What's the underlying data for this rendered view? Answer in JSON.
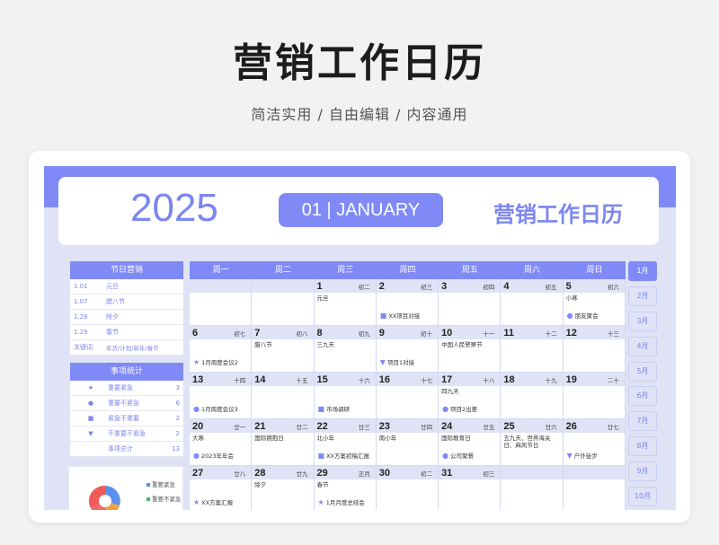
{
  "title": "营销工作日历",
  "subtitle": "简洁实用 / 自由编辑 / 内容通用",
  "header": {
    "year": "2025",
    "month": "01 | JANUARY",
    "brand": "营销工作日历"
  },
  "holidays": {
    "head": "节日营销",
    "rows": [
      {
        "date": "1.01",
        "name": "元旦"
      },
      {
        "date": "1.07",
        "name": "腊八节"
      },
      {
        "date": "1.28",
        "name": "除夕"
      },
      {
        "date": "1.29",
        "name": "春节"
      },
      {
        "date": "关键词",
        "name": "年货/计划/新年/春节"
      }
    ]
  },
  "stats": {
    "head": "事项统计",
    "rows": [
      {
        "icon": "★",
        "label": "重要紧急",
        "count": "3"
      },
      {
        "icon": "●",
        "label": "重要不紧急",
        "count": "6"
      },
      {
        "icon": "■",
        "label": "紧急不重要",
        "count": "2"
      },
      {
        "icon": "▼",
        "label": "不重要不紧急",
        "count": "2"
      },
      {
        "icon": "",
        "label": "事项总计",
        "count": "13"
      }
    ],
    "legend": [
      "重要紧急",
      "重要不紧急"
    ]
  },
  "weekdays": [
    "周一",
    "周二",
    "周三",
    "周四",
    "周五",
    "周六",
    "周日"
  ],
  "weeks": [
    [
      {
        "n": "",
        "l": "",
        "note": "",
        "evt": "",
        "m": ""
      },
      {
        "n": "",
        "l": "",
        "note": "",
        "evt": "",
        "m": ""
      },
      {
        "n": "1",
        "l": "初二",
        "note": "元旦",
        "evt": "",
        "m": ""
      },
      {
        "n": "2",
        "l": "初三",
        "note": "",
        "evt": "XX项目对接",
        "m": "■"
      },
      {
        "n": "3",
        "l": "初四",
        "note": "",
        "evt": "",
        "m": ""
      },
      {
        "n": "4",
        "l": "初五",
        "note": "",
        "evt": "",
        "m": ""
      },
      {
        "n": "5",
        "l": "初六",
        "note": "小寒",
        "evt": "朋友聚会",
        "m": "●"
      }
    ],
    [
      {
        "n": "6",
        "l": "初七",
        "note": "",
        "evt": "1月周度会议2",
        "m": "★"
      },
      {
        "n": "7",
        "l": "初八",
        "note": "腊八节",
        "evt": "",
        "m": ""
      },
      {
        "n": "8",
        "l": "初九",
        "note": "三九天",
        "evt": "",
        "m": ""
      },
      {
        "n": "9",
        "l": "初十",
        "note": "",
        "evt": "项目1对接",
        "m": "▼"
      },
      {
        "n": "10",
        "l": "十一",
        "note": "中国人民警察节",
        "evt": "",
        "m": ""
      },
      {
        "n": "11",
        "l": "十二",
        "note": "",
        "evt": "",
        "m": ""
      },
      {
        "n": "12",
        "l": "十三",
        "note": "",
        "evt": "",
        "m": ""
      }
    ],
    [
      {
        "n": "13",
        "l": "十四",
        "note": "",
        "evt": "1月周度会议3",
        "m": "●"
      },
      {
        "n": "14",
        "l": "十五",
        "note": "",
        "evt": "",
        "m": ""
      },
      {
        "n": "15",
        "l": "十六",
        "note": "",
        "evt": "市场调研",
        "m": "■"
      },
      {
        "n": "16",
        "l": "十七",
        "note": "",
        "evt": "",
        "m": ""
      },
      {
        "n": "17",
        "l": "十八",
        "note": "四九天",
        "evt": "项目2出差",
        "m": "●"
      },
      {
        "n": "18",
        "l": "十九",
        "note": "",
        "evt": "",
        "m": ""
      },
      {
        "n": "19",
        "l": "二十",
        "note": "",
        "evt": "",
        "m": ""
      }
    ],
    [
      {
        "n": "20",
        "l": "廿一",
        "note": "大寒",
        "evt": "2023年年会",
        "m": "●"
      },
      {
        "n": "21",
        "l": "廿二",
        "note": "国际拥抱日",
        "evt": "",
        "m": ""
      },
      {
        "n": "22",
        "l": "廿三",
        "note": "北小年",
        "evt": "XX方案初稿汇报",
        "m": "■"
      },
      {
        "n": "23",
        "l": "廿四",
        "note": "南小年",
        "evt": "",
        "m": ""
      },
      {
        "n": "24",
        "l": "廿五",
        "note": "国际教育日",
        "evt": "公司聚餐",
        "m": "●"
      },
      {
        "n": "25",
        "l": "廿六",
        "note": "五九天、世界海关日、麻风节日",
        "evt": "",
        "m": ""
      },
      {
        "n": "26",
        "l": "廿七",
        "note": "",
        "evt": "户外徒步",
        "m": "▼"
      }
    ],
    [
      {
        "n": "27",
        "l": "廿八",
        "note": "",
        "evt": "XX方案汇报",
        "m": "★"
      },
      {
        "n": "28",
        "l": "廿九",
        "note": "除夕",
        "evt": "",
        "m": ""
      },
      {
        "n": "29",
        "l": "正月",
        "note": "春节",
        "evt": "1月月度总结会",
        "m": "★"
      },
      {
        "n": "30",
        "l": "初二",
        "note": "",
        "evt": "",
        "m": ""
      },
      {
        "n": "31",
        "l": "初三",
        "note": "",
        "evt": "",
        "m": ""
      },
      {
        "n": "",
        "l": "",
        "note": "",
        "evt": "",
        "m": ""
      },
      {
        "n": "",
        "l": "",
        "note": "",
        "evt": "",
        "m": ""
      }
    ]
  ],
  "months": [
    "1月",
    "2月",
    "3月",
    "4月",
    "5月",
    "6月",
    "7月",
    "8月",
    "9月",
    "10月"
  ]
}
